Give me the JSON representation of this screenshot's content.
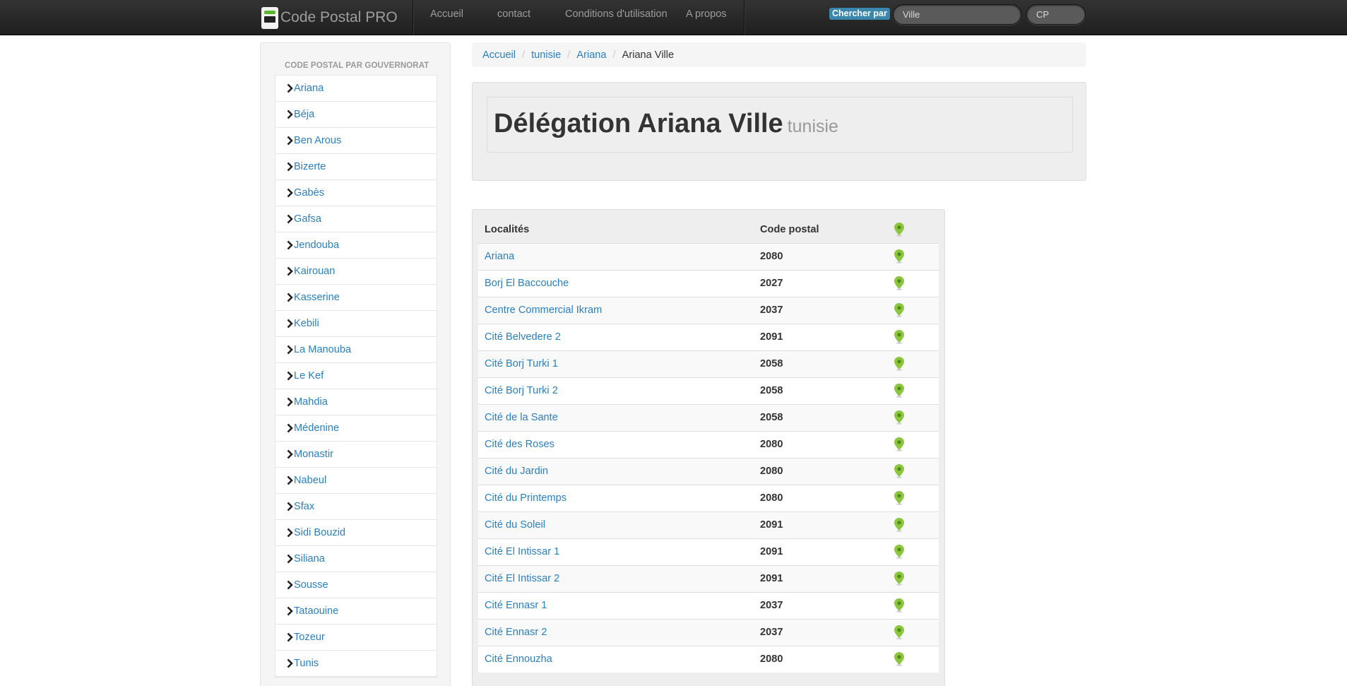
{
  "navbar": {
    "brand": "Code Postal PRO",
    "links": [
      "Accueil",
      "contact",
      "Conditions d'utilisation",
      "A propos"
    ],
    "search": {
      "label": "Chercher par",
      "ville_placeholder": "Ville",
      "cp_placeholder": "CP"
    }
  },
  "sidebar": {
    "heading": "Code postal par gouvernorat",
    "items": [
      "Ariana",
      "Béja",
      "Ben Arous",
      "Bizerte",
      "Gabès",
      "Gafsa",
      "Jendouba",
      "Kairouan",
      "Kasserine",
      "Kebili",
      "La Manouba",
      "Le Kef",
      "Mahdia",
      "Médenine",
      "Monastir",
      "Nabeul",
      "Sfax",
      "Sidi Bouzid",
      "Siliana",
      "Sousse",
      "Tataouine",
      "Tozeur",
      "Tunis"
    ]
  },
  "breadcrumb": {
    "items": [
      "Accueil",
      "tunisie",
      "Ariana"
    ],
    "active": "Ariana Ville"
  },
  "hero": {
    "title": "Délégation Ariana Ville",
    "subtitle": "tunisie"
  },
  "table": {
    "headers": {
      "locality": "Localités",
      "code": "Code postal"
    },
    "rows": [
      {
        "locality": "Ariana",
        "code": "2080"
      },
      {
        "locality": "Borj El Baccouche",
        "code": "2027"
      },
      {
        "locality": "Centre Commercial Ikram",
        "code": "2037"
      },
      {
        "locality": "Cité Belvedere 2",
        "code": "2091"
      },
      {
        "locality": "Cité Borj Turki 1",
        "code": "2058"
      },
      {
        "locality": "Cité Borj Turki 2",
        "code": "2058"
      },
      {
        "locality": "Cité de la Sante",
        "code": "2058"
      },
      {
        "locality": "Cité des Roses",
        "code": "2080"
      },
      {
        "locality": "Cité du Jardin",
        "code": "2080"
      },
      {
        "locality": "Cité du Printemps",
        "code": "2080"
      },
      {
        "locality": "Cité du Soleil",
        "code": "2091"
      },
      {
        "locality": "Cité El Intissar 1",
        "code": "2091"
      },
      {
        "locality": "Cité El Intissar 2",
        "code": "2091"
      },
      {
        "locality": "Cité Ennasr 1",
        "code": "2037"
      },
      {
        "locality": "Cité Ennasr 2",
        "code": "2037"
      },
      {
        "locality": "Cité Ennouzha",
        "code": "2080"
      }
    ]
  },
  "colors": {
    "link": "#2a7fc0",
    "map_pin": "#8cc63f",
    "navbar": "#222222",
    "search_label": "#3a87ad"
  },
  "icons": {
    "nav_item": "chevron-right-icon",
    "map": "map-pin-icon"
  }
}
